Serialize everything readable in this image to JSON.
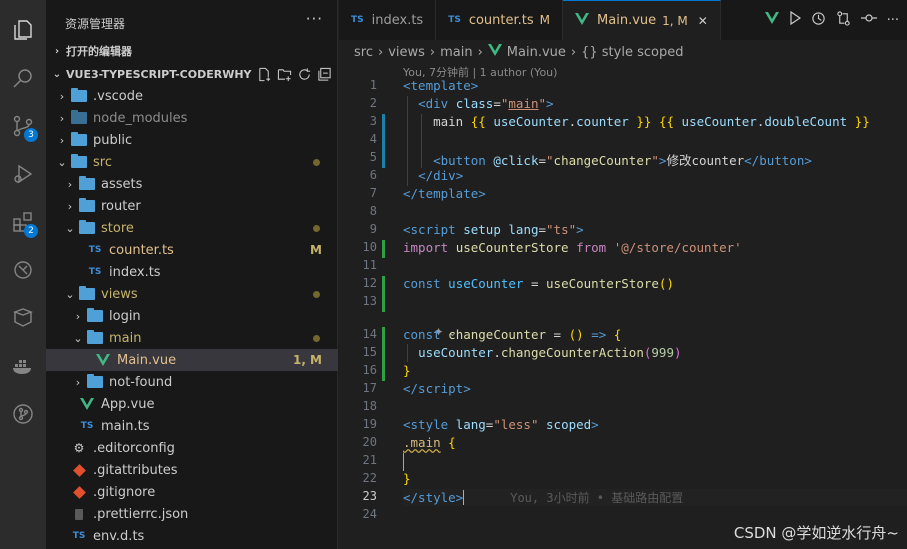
{
  "explorer": {
    "title": "资源管理器",
    "more": "···",
    "open_editors": "打开的编辑器",
    "project": "VUE3-TYPESCRIPT-CODERWHY"
  },
  "activity": {
    "scm_badge": "3",
    "ext_badge": "2"
  },
  "tree": [
    {
      "label": ".vscode",
      "type": "folder",
      "depth": 1,
      "twisty": "›"
    },
    {
      "label": "node_modules",
      "type": "folder-dim",
      "depth": 1,
      "twisty": "›"
    },
    {
      "label": "public",
      "type": "folder",
      "depth": 1,
      "twisty": "›"
    },
    {
      "label": "src",
      "type": "folder-open",
      "depth": 1,
      "twisty": "⌄",
      "dot": true
    },
    {
      "label": "assets",
      "type": "folder",
      "depth": 2,
      "twisty": "›"
    },
    {
      "label": "router",
      "type": "folder",
      "depth": 2,
      "twisty": "›"
    },
    {
      "label": "store",
      "type": "folder-open",
      "depth": 2,
      "twisty": "⌄",
      "dot": true
    },
    {
      "label": "counter.ts",
      "type": "ts",
      "depth": 3,
      "status": "M"
    },
    {
      "label": "index.ts",
      "type": "ts",
      "depth": 3
    },
    {
      "label": "views",
      "type": "folder-open",
      "depth": 2,
      "twisty": "⌄",
      "dot": true
    },
    {
      "label": "login",
      "type": "folder",
      "depth": 3,
      "twisty": "›"
    },
    {
      "label": "main",
      "type": "folder-open",
      "depth": 3,
      "twisty": "⌄",
      "dot": true
    },
    {
      "label": "Main.vue",
      "type": "vue",
      "depth": 4,
      "status": "1, M",
      "selected": true
    },
    {
      "label": "not-found",
      "type": "folder",
      "depth": 3,
      "twisty": "›"
    },
    {
      "label": "App.vue",
      "type": "vue",
      "depth": 2
    },
    {
      "label": "main.ts",
      "type": "ts",
      "depth": 2
    },
    {
      "label": ".editorconfig",
      "type": "gear",
      "depth": 1
    },
    {
      "label": ".gitattributes",
      "type": "git",
      "depth": 1
    },
    {
      "label": ".gitignore",
      "type": "git",
      "depth": 1
    },
    {
      "label": ".prettierrc.json",
      "type": "json",
      "depth": 1
    },
    {
      "label": "env.d.ts",
      "type": "ts",
      "depth": 1
    }
  ],
  "tabs": [
    {
      "label": "index.ts",
      "icon": "TS"
    },
    {
      "label": "counter.ts",
      "icon": "TS",
      "mod": "M"
    },
    {
      "label": "Main.vue",
      "icon": "V",
      "mod": "1, M",
      "active": true
    }
  ],
  "breadcrumb": [
    "src",
    "views",
    "main",
    "Main.vue",
    "{} style scoped"
  ],
  "blame_top": "You, 7分钟前 | 1 author (You)",
  "inline_blame": "You, 3小时前 • 基础路由配置",
  "code_lines": [
    "1",
    "2",
    "3",
    "4",
    "5",
    "6",
    "7",
    "8",
    "9",
    "10",
    "11",
    "12",
    "13",
    "14",
    "15",
    "16",
    "17",
    "18",
    "19",
    "20",
    "21",
    "22",
    "23",
    "24"
  ],
  "button_text": "修改counter",
  "watermark": "CSDN @学如逆水行舟~",
  "colors": {
    "accent": "#0078d4",
    "modified": "#e2c08d",
    "added": "#2ea043"
  }
}
